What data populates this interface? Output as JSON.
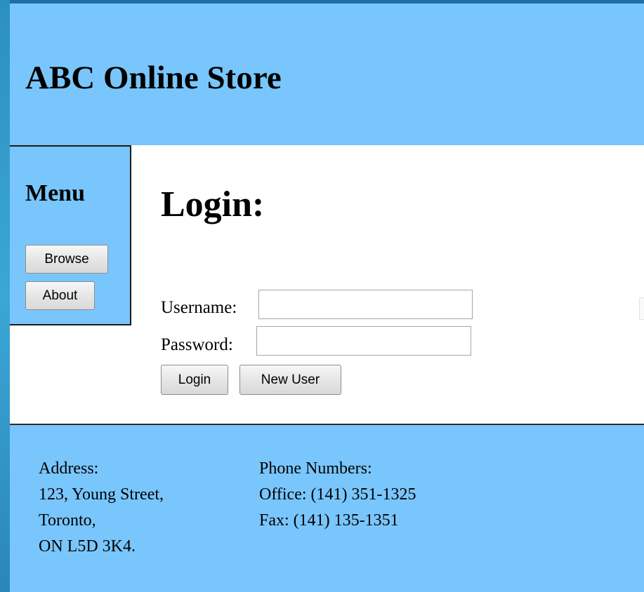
{
  "header": {
    "title": "ABC Online Store"
  },
  "menu": {
    "title": "Menu",
    "browse_label": "Browse",
    "about_label": "About"
  },
  "login": {
    "title": "Login:",
    "username_label": "Username:",
    "username_value": "",
    "password_label": "Password:",
    "password_value": "",
    "login_button": "Login",
    "new_user_button": "New User"
  },
  "footer": {
    "address": {
      "heading": "Address:",
      "line1": "123, Young Street,",
      "line2": "Toronto,",
      "line3": "ON L5D 3K4."
    },
    "phones": {
      "heading": "Phone Numbers:",
      "office": "Office: (141) 351-1325",
      "fax": "Fax: (141) 135-1351"
    }
  },
  "colors": {
    "panel_blue": "#79c6fc",
    "content_white": "#ffffff",
    "desktop_blue": "#2a86bd"
  }
}
